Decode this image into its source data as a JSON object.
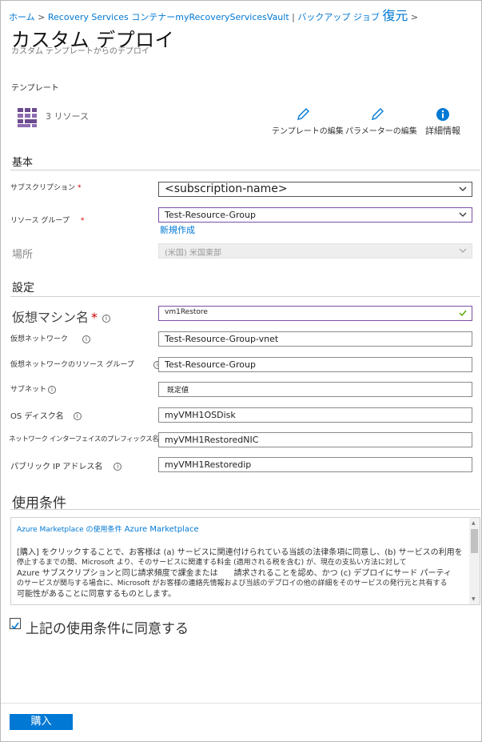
{
  "breadcrumb": {
    "home": "ホーム",
    "vault": "Recovery Services コンテナー",
    "vault_name": "myRecoveryServicesVault",
    "jobs": "バックアップ ジョブ",
    "restore": "復元"
  },
  "page": {
    "title": "カスタム デプロイ",
    "subtitle": "カスタム テンプレートからのデプロイ"
  },
  "template": {
    "label": "テンプレート",
    "resource_count": "3 リソース",
    "actions": [
      {
        "label": "テンプレートの編集",
        "icon": "pencil-icon"
      },
      {
        "label": "パラメーターの編集",
        "icon": "pencil-icon"
      },
      {
        "label": "詳細情報",
        "icon": "info-icon"
      }
    ]
  },
  "basics": {
    "heading": "基本",
    "subscription_label": "サブスクリプション",
    "subscription_value": "<subscription-name>",
    "resource_group_label": "リソース グループ",
    "resource_group_value": "Test-Resource-Group",
    "create_new": "新規作成",
    "location_label": "場所",
    "location_value": "(米国) 米国東部"
  },
  "settings": {
    "heading": "設定",
    "vm_name_label": "仮想マシン名",
    "vm_name_value": "vm1Restore",
    "vnet_label": "仮想ネットワーク",
    "vnet_value": "Test-Resource-Group-vnet",
    "vnet_rg_label": "仮想ネットワークのリソース グループ",
    "vnet_rg_value": "Test-Resource-Group",
    "subnet_label": "サブネット",
    "subnet_value": "既定値",
    "os_disk_label": "OS ディスク名",
    "os_disk_value": "myVMH1OSDisk",
    "nic_prefix_label": "ネットワーク インターフェイスのプレフィックス名",
    "nic_prefix_value": "myVMH1RestoredNIC",
    "pip_label": "パブリック IP アドレス名",
    "pip_value": "myVMH1Restoredip"
  },
  "terms": {
    "heading": "使用条件",
    "link_prefix": "Azure Marketplace の使用条件",
    "link_text": "Azure Marketplace",
    "line1": "[購入] をクリックすることで、お客様は (a) サービスに関連付けられている当該の法律条項に同意し、(b) サービスの利用を",
    "line2": "停止するまでの間、Microsoft より、そのサービスに関連する料金 (適用される税を含む) が、現在の支払い方法に対して",
    "line3": "Azure サブスクリプションと同じ請求頻度で課金または　　請求されることを認め、かつ (c) デプロイにサード パーティ",
    "line4": "のサービスが関与する場合に、Microsoft がお客様の連絡先情報および当該のデプロイの他の詳細をそのサービスの発行元と共有する",
    "line5": "可能性があることに同意するものとします。",
    "agree": "上記の使用条件に同意する"
  },
  "footer": {
    "purchase": "購入"
  },
  "colors": {
    "accent": "#0078d4",
    "required": "#c00000",
    "focus_border": "#7a4fa3"
  }
}
